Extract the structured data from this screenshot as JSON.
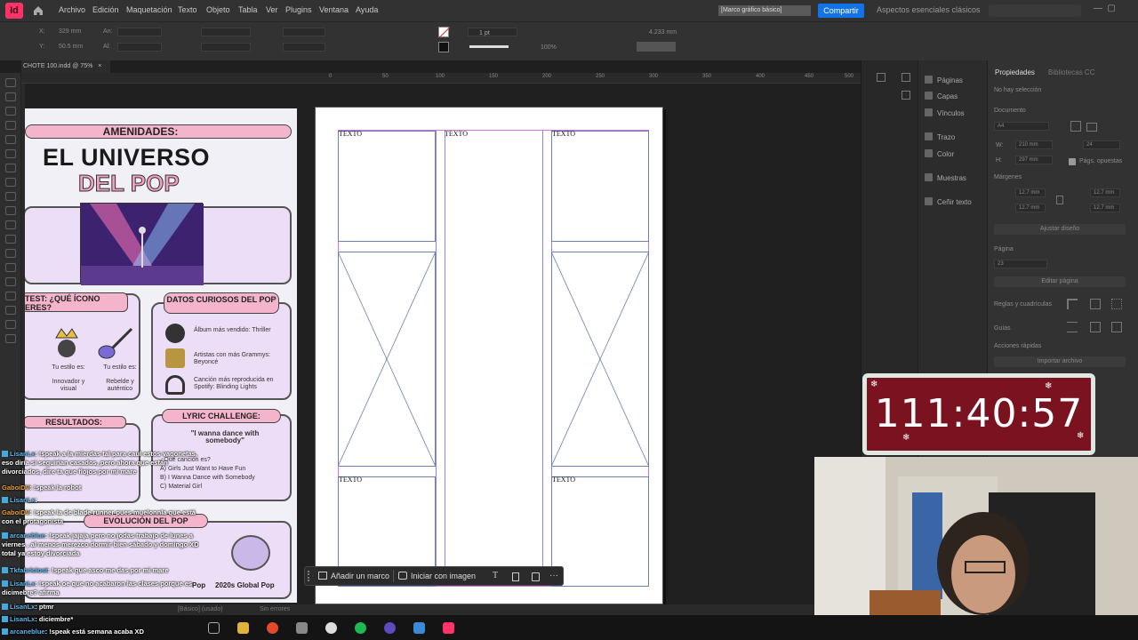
{
  "app": {
    "logo": "Id",
    "menu": [
      "Archivo",
      "Edición",
      "Maquetación",
      "Texto",
      "Objeto",
      "Tabla",
      "Ver",
      "Plugins",
      "Ventana",
      "Ayuda"
    ],
    "share_label": "Compartir",
    "workspace": "Aspectos esenciales clásicos",
    "accent_color": "#ff3366"
  },
  "control_bar": {
    "x_label": "X:",
    "x_value": "329 mm",
    "y_label": "Y:",
    "y_value": "50.5 mm",
    "an_label": "An:",
    "al_label": "Al:",
    "stroke_weight": "1 pt",
    "scale": "100%",
    "size_value": "4.233 mm",
    "frame_style": "[Marco gráfico básico]"
  },
  "document": {
    "tab_title": "CHOTE 100.indd @ 75%",
    "close_icon": "×",
    "ruler_marks": [
      "0",
      "50",
      "100",
      "150",
      "200",
      "250",
      "300",
      "350",
      "400",
      "450",
      "500"
    ],
    "frames": [
      "TEXTO",
      "TEXTO",
      "TEXTO",
      "TEXTO",
      "TEXTO"
    ]
  },
  "infographic": {
    "amenidades": "AMENIDADES:",
    "title_1": "EL UNIVERSO",
    "title_2": "DEL POP",
    "test_title": "TEST: ¿QUÉ ÍCONO ERES?",
    "datos_title": "DATOS CURIOSOS DEL POP",
    "datos_items": [
      "Álbum más vendido: Thriller",
      "Artistas con más Grammys: Beyoncé",
      "Canción más reproducida en Spotify: Blinding Lights"
    ],
    "test_items": [
      "Tu estilo es:",
      "Tu estilo es:",
      "Innovador y visual",
      "Rebelde y auténtico"
    ],
    "results_title": "RESULTADOS:",
    "lyric_title": "LYRIC CHALLENGE:",
    "lyric_quote": "\"I wanna dance with somebody\"",
    "lyric_question": "¿Qué canción es?",
    "lyric_options": [
      "A) Girls Just Want to Have Fun",
      "B) I Wanna Dance with Somebody",
      "C) Material Girl"
    ],
    "evolution_title": "EVOLUCIÓN DEL POP",
    "evolution_items": [
      "Pop",
      "2020s Global Pop"
    ]
  },
  "context_bar": {
    "add_frame": "Añadir un marco",
    "start_with_image": "Iniciar con imagen"
  },
  "status": {
    "style": "[Básico] (usado)",
    "errors": "Sin errores"
  },
  "panels": {
    "list": [
      "Páginas",
      "Capas",
      "Vínculos",
      "Trazo",
      "Color",
      "Muestras",
      "Ceñir texto"
    ],
    "tabs": [
      "Propiedades",
      "Bibliotecas CC"
    ],
    "no_selection": "No hay selección",
    "document_label": "Documento",
    "page_size": "A4",
    "width_label": "W:",
    "width_value": "210 mm",
    "height_label": "H:",
    "height_value": "297 mm",
    "pages_count": "24",
    "facing_pages": "Págs. opuestas",
    "margins_label": "Márgenes",
    "margin_value": "12.7 mm",
    "adjust_layout": "Ajustar diseño",
    "page_label": "Página",
    "page_value": "23",
    "edit_page": "Editar página",
    "rulers_grids": "Reglas y cuadrículas",
    "guides": "Guías",
    "quick_actions": "Acciones rápidas",
    "import_file": "Importar archivo"
  },
  "timer": {
    "value": "111:40:57",
    "bg_color": "#7b1220"
  },
  "chat": [
    {
      "user": "LisanLx",
      "text": ": !speak a la mierdas tal para caul estos vagonetas, eso diría si seguirían casados, pero ahora que estan divorciados, dire ta que flojos por mi mare",
      "alt": false
    },
    {
      "user": "GaboiDV",
      "text": ": !speak la robot",
      "alt": true
    },
    {
      "user": "LisanLx",
      "text": ":",
      "alt": false
    },
    {
      "user": "GaboiDV",
      "text": ": !speak la de blade runner pues muelonnla que está con el protagonista",
      "alt": true
    },
    {
      "user": "arcaneblue",
      "text": ": !speak jajaja pero no jodas trabajo de lunes a viernes , al menos merezco dormir bien sábado y domingo XD total ya estoy divorciada",
      "alt": false
    },
    {
      "user": "Tkfabriciost",
      "text": ": !speak que asco me das por mi mare",
      "alt": false
    },
    {
      "user": "LisanLx",
      "text": ": !speak oe que no acabaron las clases porque es dicimebre? afirma",
      "alt": false
    },
    {
      "user": "LisanLx",
      "text": ": ptmr",
      "alt": false
    },
    {
      "user": "LisanLx",
      "text": ": diciembre*",
      "alt": false
    },
    {
      "user": "arcaneblue",
      "text": ": !speak está semana acaba XD",
      "alt": false
    }
  ]
}
